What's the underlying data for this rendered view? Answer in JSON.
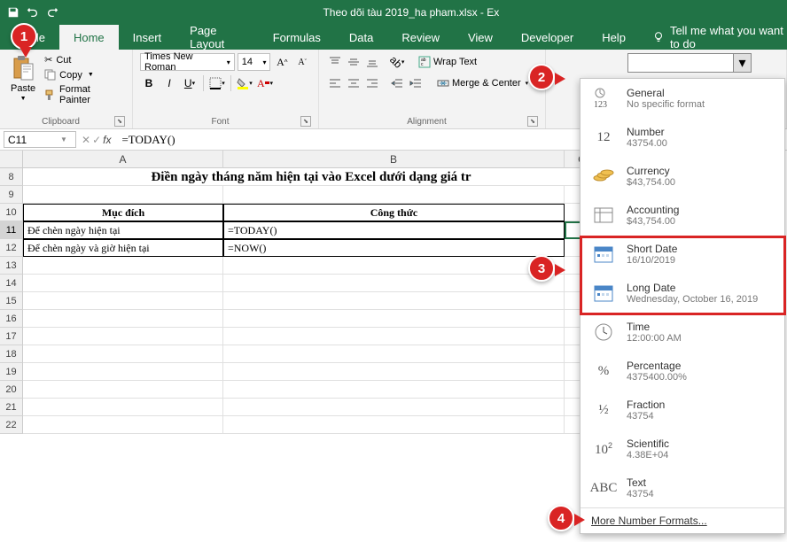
{
  "title": "Theo dõi tàu 2019_ha pham.xlsx  -  Ex",
  "tabs": [
    "File",
    "Home",
    "Insert",
    "Page Layout",
    "Formulas",
    "Data",
    "Review",
    "View",
    "Developer",
    "Help"
  ],
  "tellme": "Tell me what you want to do",
  "clipboard": {
    "paste": "Paste",
    "cut": "Cut",
    "copy": "Copy",
    "painter": "Format Painter",
    "label": "Clipboard"
  },
  "font": {
    "name": "Times New Roman",
    "size": "14",
    "label": "Font"
  },
  "alignment": {
    "wrap": "Wrap Text",
    "merge": "Merge & Center",
    "label": "Alignment"
  },
  "namebox": "C11",
  "formula": "=TODAY()",
  "colA_width": 226,
  "colB_width": 385,
  "colC_width": 40,
  "cols": [
    "A",
    "B",
    "C"
  ],
  "rows": [
    8,
    9,
    10,
    11,
    12,
    13,
    14,
    15,
    16,
    17,
    18,
    19,
    20,
    21,
    22
  ],
  "sheet": {
    "title": "Điền ngày tháng năm hiện tại vào Excel dưới dạng giá tr",
    "h_a": "Mục đích",
    "h_b": "Công thức",
    "r11a": "Để chèn ngày hiện tại",
    "r11b": "=TODAY()",
    "r12a": "Để chèn ngày và giờ hiện tại",
    "r12b": "=NOW()"
  },
  "formats": [
    {
      "icon": "123",
      "name": "General",
      "sample": "No specific format"
    },
    {
      "icon": "12",
      "name": "Number",
      "sample": "43754.00"
    },
    {
      "icon": "cur",
      "name": "Currency",
      "sample": "$43,754.00"
    },
    {
      "icon": "acc",
      "name": "Accounting",
      "sample": "$43,754.00"
    },
    {
      "icon": "cal",
      "name": "Short Date",
      "sample": "16/10/2019"
    },
    {
      "icon": "cal",
      "name": "Long Date",
      "sample": "Wednesday, October 16, 2019"
    },
    {
      "icon": "clk",
      "name": "Time",
      "sample": "12:00:00 AM"
    },
    {
      "icon": "%",
      "name": "Percentage",
      "sample": "4375400.00%"
    },
    {
      "icon": "½",
      "name": "Fraction",
      "sample": "43754"
    },
    {
      "icon": "sci",
      "name": "Scientific",
      "sample": "4.38E+04"
    },
    {
      "icon": "ABC",
      "name": "Text",
      "sample": "43754"
    }
  ],
  "more_formats": "More Number Formats...",
  "balloons": {
    "1": "1",
    "2": "2",
    "3": "3",
    "4": "4"
  }
}
